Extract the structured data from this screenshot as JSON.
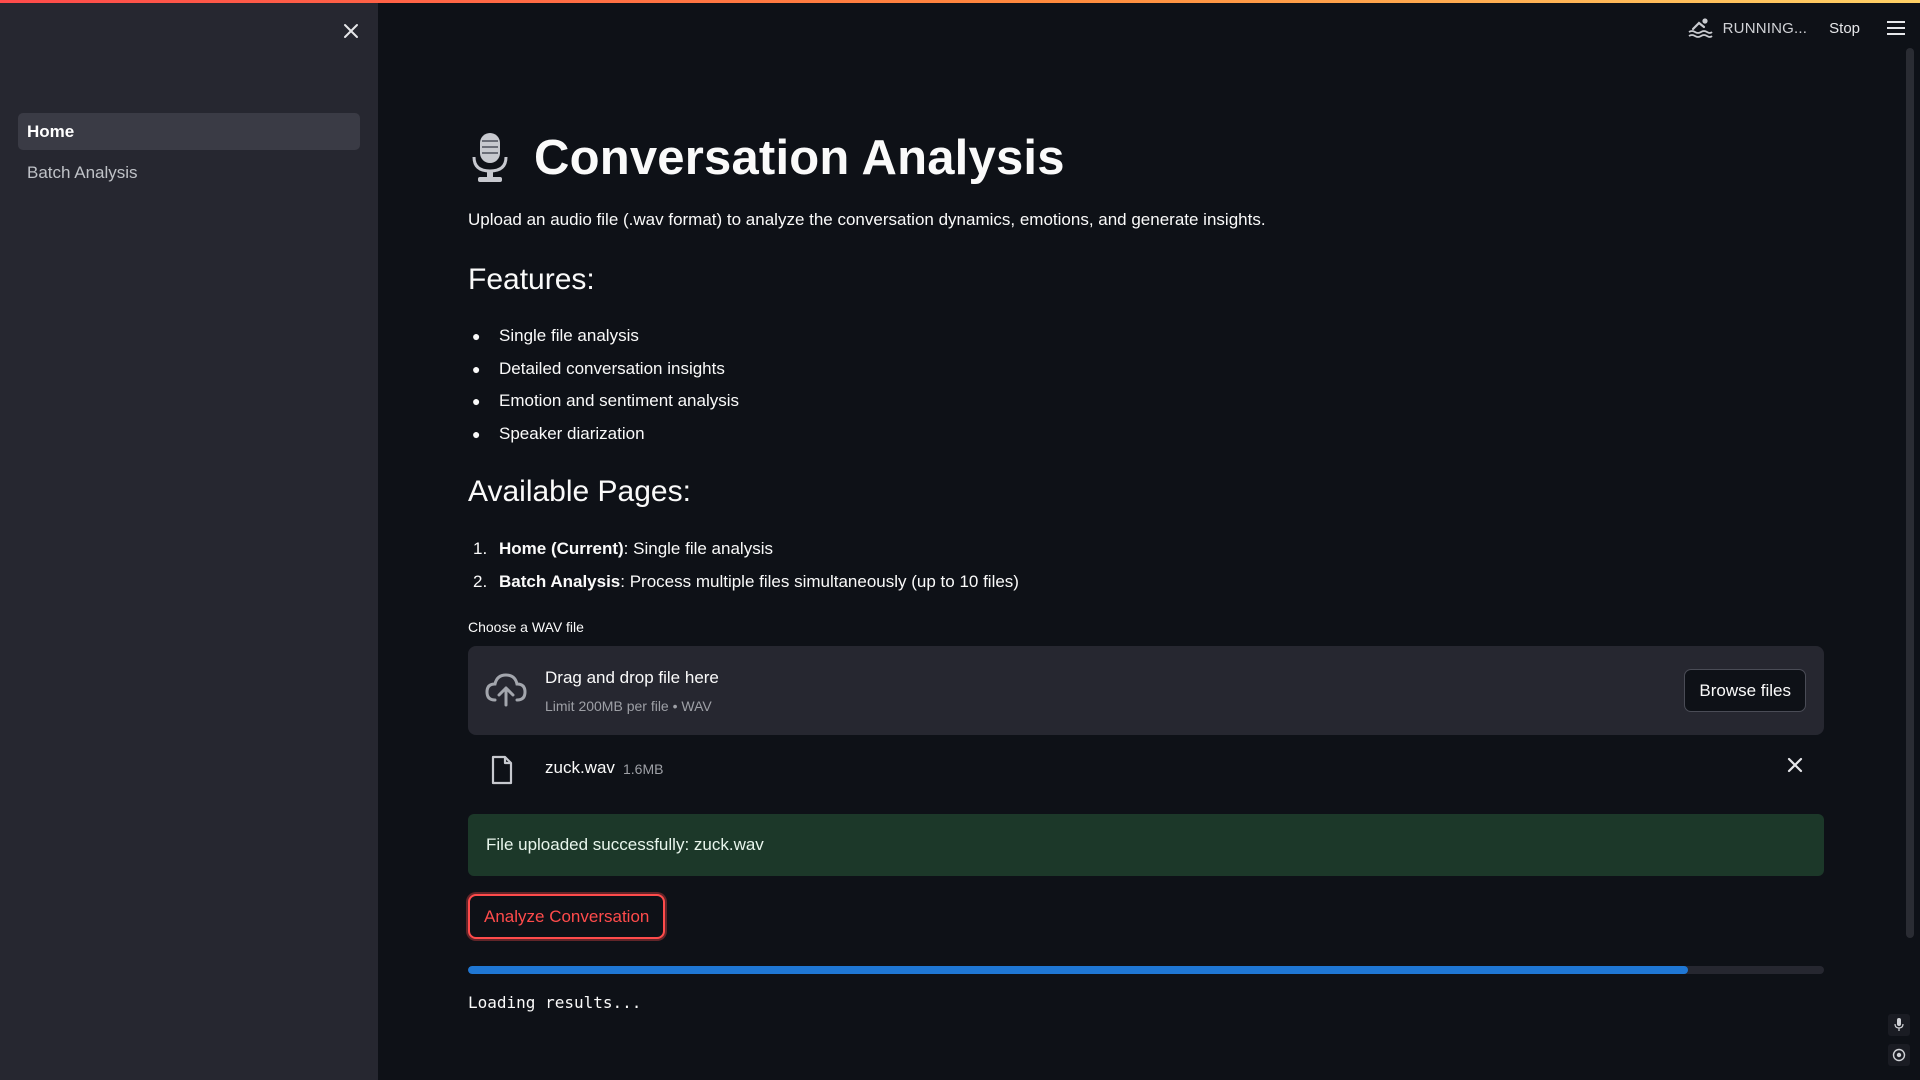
{
  "sidebar": {
    "items": [
      {
        "label": "Home",
        "active": true
      },
      {
        "label": "Batch Analysis",
        "active": false
      }
    ]
  },
  "header": {
    "status": "RUNNING...",
    "stop_label": "Stop"
  },
  "main": {
    "title_icon": "microphone-icon",
    "title": "Conversation Analysis",
    "intro": "Upload an audio file (.wav format) to analyze the conversation dynamics, emotions, and generate insights.",
    "features_heading": "Features:",
    "features": [
      "Single file analysis",
      "Detailed conversation insights",
      "Emotion and sentiment analysis",
      "Speaker diarization"
    ],
    "pages_heading": "Available Pages:",
    "pages": [
      {
        "num": "1.",
        "name": "Home (Current)",
        "desc": ": Single file analysis"
      },
      {
        "num": "2.",
        "name": "Batch Analysis",
        "desc": ": Process multiple files simultaneously (up to 10 files)"
      }
    ]
  },
  "uploader": {
    "label": "Choose a WAV file",
    "drop_title": "Drag and drop file here",
    "drop_limit": "Limit 200MB per file • WAV",
    "browse_label": "Browse files",
    "file": {
      "name": "zuck.wav",
      "size": "1.6MB"
    }
  },
  "success_message": "File uploaded successfully: zuck.wav",
  "analyze_label": "Analyze Conversation",
  "progress": {
    "value": 0.9
  },
  "loading_text": "Loading results...",
  "colors": {
    "background": "#0e1117",
    "sidebar": "#262730",
    "accent": "#ff4b4b",
    "success_bg": "#1c3829",
    "progress": "#1f77d4"
  }
}
